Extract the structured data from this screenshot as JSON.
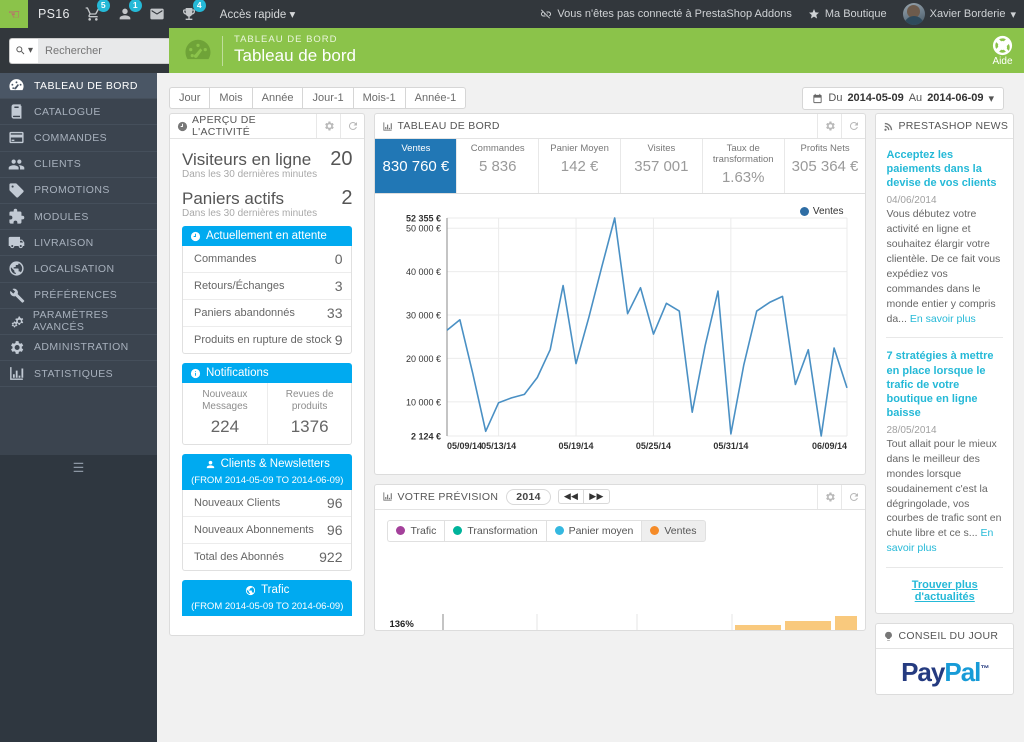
{
  "topbar": {
    "shop_name": "PS16",
    "icons": [
      {
        "name": "cart-icon",
        "badge": "5"
      },
      {
        "name": "user-icon",
        "badge": "1"
      },
      {
        "name": "envelope-icon",
        "badge": ""
      },
      {
        "name": "trophy-icon",
        "badge": "4"
      }
    ],
    "quick_access": "Accès rapide",
    "addons_status": "Vous n'êtes pas connecté à PrestaShop Addons",
    "my_shop": "Ma Boutique",
    "user_name": "Xavier Borderie"
  },
  "search": {
    "placeholder": "Rechercher"
  },
  "page_header": {
    "kicker": "TABLEAU DE BORD",
    "title": "Tableau de bord",
    "help_label": "Aide"
  },
  "sidebar": {
    "items": [
      {
        "label": "TABLEAU DE BORD",
        "icon": "dashboard-icon",
        "active": true
      },
      {
        "label": "CATALOGUE",
        "icon": "book-icon",
        "active": false
      },
      {
        "label": "COMMANDES",
        "icon": "credit-card-icon",
        "active": false
      },
      {
        "label": "CLIENTS",
        "icon": "people-icon",
        "active": false
      },
      {
        "label": "PROMOTIONS",
        "icon": "tag-icon",
        "active": false
      },
      {
        "label": "MODULES",
        "icon": "puzzle-icon",
        "active": false
      },
      {
        "label": "LIVRAISON",
        "icon": "truck-icon",
        "active": false
      },
      {
        "label": "LOCALISATION",
        "icon": "globe-icon",
        "active": false
      },
      {
        "label": "PRÉFÉRENCES",
        "icon": "wrench-icon",
        "active": false
      },
      {
        "label": "PARAMÈTRES AVANCÉS",
        "icon": "cogs-icon",
        "active": false
      },
      {
        "label": "ADMINISTRATION",
        "icon": "gear-icon",
        "active": false
      },
      {
        "label": "STATISTIQUES",
        "icon": "bar-chart-icon",
        "active": false
      }
    ]
  },
  "toolbar": {
    "period_buttons": [
      "Jour",
      "Mois",
      "Année",
      "Jour-1",
      "Mois-1",
      "Année-1"
    ],
    "date_prefix": "Du",
    "date_from": "2014-05-09",
    "date_mid": "Au",
    "date_to": "2014-06-09"
  },
  "activity": {
    "title": "APERÇU DE L'ACTIVITÉ",
    "visitors_label": "Visiteurs en ligne",
    "visitors_value": "20",
    "visitors_sub": "Dans les 30 dernières minutes",
    "carts_label": "Paniers actifs",
    "carts_value": "2",
    "carts_sub": "Dans les 30 dernières minutes",
    "pending_title": "Actuellement en attente",
    "pending_rows": [
      {
        "label": "Commandes",
        "value": "0"
      },
      {
        "label": "Retours/Échanges",
        "value": "3"
      },
      {
        "label": "Paniers abandonnés",
        "value": "33"
      },
      {
        "label": "Produits en rupture de stock",
        "value": "9"
      }
    ],
    "notifications_title": "Notifications",
    "notifications": [
      {
        "label": "Nouveaux Messages",
        "value": "224"
      },
      {
        "label": "Revues de produits",
        "value": "1376"
      }
    ],
    "clients_title": "Clients & Newsletters",
    "clients_sub": "(FROM 2014-05-09 TO 2014-06-09)",
    "clients_rows": [
      {
        "label": "Nouveaux Clients",
        "value": "96"
      },
      {
        "label": "Nouveaux Abonnements",
        "value": "96"
      },
      {
        "label": "Total des Abonnés",
        "value": "922"
      }
    ],
    "traffic_title": "Trafic",
    "traffic_sub": "(FROM 2014-05-09 TO 2014-06-09)"
  },
  "dashboard": {
    "title": "TABLEAU DE BORD",
    "kpis": [
      {
        "label": "Ventes",
        "value": "830 760 €",
        "active": true
      },
      {
        "label": "Commandes",
        "value": "5 836",
        "active": false
      },
      {
        "label": "Panier Moyen",
        "value": "142 €",
        "active": false
      },
      {
        "label": "Visites",
        "value": "357 001",
        "active": false
      },
      {
        "label": "Taux de transformation",
        "value": "1.63%",
        "active": false
      },
      {
        "label": "Profits Nets",
        "value": "305 364 €",
        "active": false
      }
    ]
  },
  "chart_data": {
    "type": "line",
    "title": "Ventes",
    "xlabel": "",
    "ylabel": "",
    "legend": [
      "Ventes"
    ],
    "legend_position": "top-right",
    "grid": true,
    "series_color": "#4a90c4",
    "ylim": [
      2124,
      52355
    ],
    "ytick_labels": [
      "52 355 €",
      "50 000 €",
      "40 000 €",
      "30 000 €",
      "20 000 €",
      "10 000 €",
      "2 124 €"
    ],
    "yticks": [
      52355,
      50000,
      40000,
      30000,
      20000,
      10000,
      2124
    ],
    "xtick_labels": [
      "05/09/14",
      "05/13/14",
      "05/19/14",
      "05/25/14",
      "05/31/14",
      "06/09/14"
    ],
    "x": [
      "05/09/14",
      "05/10/14",
      "05/11/14",
      "05/12/14",
      "05/13/14",
      "05/14/14",
      "05/15/14",
      "05/16/14",
      "05/17/14",
      "05/18/14",
      "05/19/14",
      "05/20/14",
      "05/21/14",
      "05/22/14",
      "05/23/14",
      "05/24/14",
      "05/25/14",
      "05/26/14",
      "05/27/14",
      "05/28/14",
      "05/29/14",
      "05/30/14",
      "05/31/14",
      "06/01/14",
      "06/02/14",
      "06/03/14",
      "06/04/14",
      "06/05/14",
      "06/06/14",
      "06/07/14",
      "06/08/14",
      "06/09/14"
    ],
    "series": [
      {
        "name": "Ventes",
        "values": [
          26500,
          28900,
          16500,
          3200,
          9800,
          10900,
          11700,
          15600,
          22000,
          36800,
          18800,
          29500,
          41100,
          52355,
          30300,
          36300,
          25600,
          32700,
          30900,
          7600,
          22900,
          35500,
          2600,
          18500,
          30900,
          32900,
          34300,
          14000,
          22000,
          2124,
          22400,
          13200
        ],
        "color": "#4a90c4"
      }
    ]
  },
  "forecast": {
    "title": "VOTRE PRÉVISION",
    "year": "2014",
    "prev_label": "◀◀",
    "next_label": "▶▶",
    "legend": [
      {
        "label": "Trafic",
        "color": "#a4419b",
        "selected": false
      },
      {
        "label": "Transformation",
        "color": "#00b39b",
        "selected": false
      },
      {
        "label": "Panier moyen",
        "color": "#35b8e0",
        "selected": false
      },
      {
        "label": "Ventes",
        "color": "#f58b28",
        "selected": true
      }
    ],
    "y_top_label": "136%"
  },
  "news": {
    "title": "PRESTASHOP NEWS",
    "articles": [
      {
        "title": "Acceptez les paiements dans la devise de vos clients",
        "date": "04/06/2014",
        "excerpt": "Vous débutez votre activité en ligne et souhaitez élargir votre clientèle. De ce fait vous expédiez vos commandes dans le monde entier y compris da...",
        "more": "En savoir plus"
      },
      {
        "title": "7 stratégies à mettre en place lorsque le trafic de votre boutique en ligne baisse",
        "date": "28/05/2014",
        "excerpt": "Tout allait pour le mieux dans le meilleur des mondes lorsque soudainement c'est la dégringolade, vos courbes de trafic sont en chute libre et ce s...",
        "more": "En savoir plus"
      }
    ],
    "find_more": "Trouver plus d'actualités"
  },
  "tip": {
    "title": "CONSEIL DU JOUR",
    "brand_part1": "Pay",
    "brand_part2": "Pal",
    "brand_tm": "™"
  },
  "colors": {
    "accent_green": "#8bc34a",
    "accent_blue": "#00aaf0",
    "kpi_active": "#2177b5",
    "chart_line": "#4a90c4",
    "dark_nav": "#3b444f",
    "topbar": "#32373c",
    "forecast_bar": "#f9c97d"
  }
}
